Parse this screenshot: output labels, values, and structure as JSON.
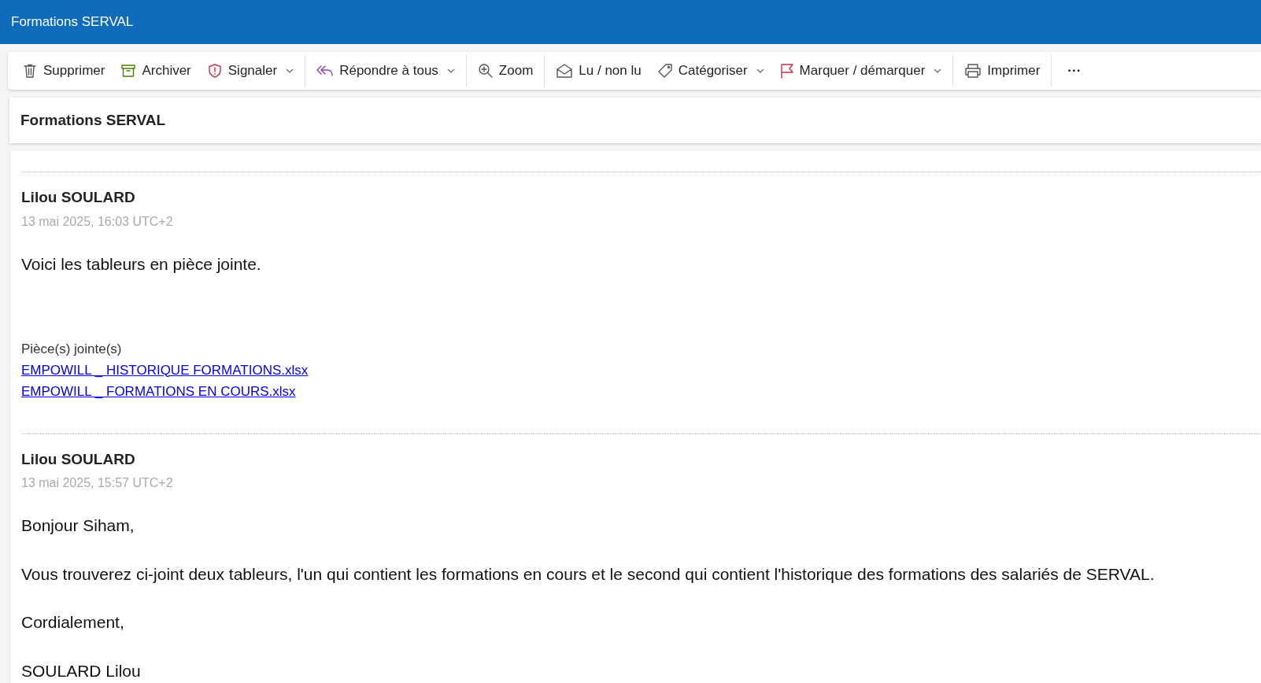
{
  "window": {
    "title": "Formations SERVAL"
  },
  "toolbar": [
    {
      "kind": "trash",
      "label": "Supprimer",
      "dropdown": false
    },
    {
      "kind": "archive",
      "label": "Archiver",
      "dropdown": false
    },
    {
      "kind": "shield",
      "label": "Signaler",
      "dropdown": true
    },
    {
      "kind": "separator"
    },
    {
      "kind": "reply-all",
      "label": "Répondre à tous",
      "dropdown": true
    },
    {
      "kind": "separator"
    },
    {
      "kind": "zoom",
      "label": "Zoom",
      "dropdown": false
    },
    {
      "kind": "separator"
    },
    {
      "kind": "envelope",
      "label": "Lu / non lu",
      "dropdown": false
    },
    {
      "kind": "tag",
      "label": "Catégoriser",
      "dropdown": true
    },
    {
      "kind": "flag",
      "label": "Marquer / démarquer",
      "dropdown": true
    },
    {
      "kind": "separator"
    },
    {
      "kind": "printer",
      "label": "Imprimer",
      "dropdown": false
    },
    {
      "kind": "separator"
    },
    {
      "kind": "more",
      "label": "···"
    }
  ],
  "subject": "Formations SERVAL",
  "messages": [
    {
      "sender": "Lilou SOULARD",
      "date": "13 mai 2025, 16:03 UTC+2",
      "paragraphs": [
        "Voici les tableurs en pièce jointe."
      ],
      "attachments_heading": "Pièce(s) jointe(s)",
      "attachments": [
        "EMPOWILL _ HISTORIQUE FORMATIONS.xlsx",
        "EMPOWILL _ FORMATIONS EN COURS.xlsx"
      ]
    },
    {
      "sender": "Lilou SOULARD",
      "date": "13 mai 2025, 15:57 UTC+2",
      "paragraphs": [
        "Bonjour Siham,",
        "Vous trouverez ci-joint deux tableurs, l'un qui contient les formations en cours et le second qui contient l'historique des formations des salariés de SERVAL.",
        "Cordialement,",
        "SOULARD Lilou"
      ]
    }
  ]
}
